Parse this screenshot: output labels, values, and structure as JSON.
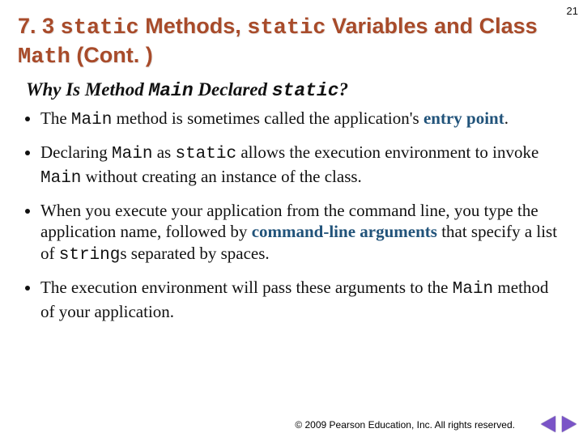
{
  "page_number": "21",
  "title": {
    "pre": "7. 3 ",
    "kw1": "static",
    "between1": " Methods, ",
    "kw2": "static",
    "between2": " Variables and Class ",
    "kw3": "Math",
    "suffix": " (Cont. )"
  },
  "subhead": {
    "pre": "Why Is Method ",
    "kw1": "Main",
    "mid": " Declared ",
    "kw2": "static",
    "suffix": "?"
  },
  "bullets": {
    "b1a": "The ",
    "b1_main": "Main",
    "b1b": " method is sometimes called the application's ",
    "b1_term": "entry point",
    "b1c": ".",
    "b2a": "Declaring ",
    "b2_main": "Main",
    "b2b": " as ",
    "b2_static": "static",
    "b2c": " allows the execution environment to invoke ",
    "b2_main2": "Main",
    "b2d": " without creating an instance of the class.",
    "b3a": "When you execute your application from the command line, you type the application name, followed by ",
    "b3_term": "command-line arguments",
    "b3b": " that specify a list of ",
    "b3_code": "string",
    "b3c": "s separated by spaces.",
    "b4a": "The execution environment will pass these arguments to the ",
    "b4_main": "Main",
    "b4b": " method of your application."
  },
  "footer": {
    "copy_symbol": "©",
    "text": " 2009 Pearson Education, Inc. All rights reserved."
  }
}
